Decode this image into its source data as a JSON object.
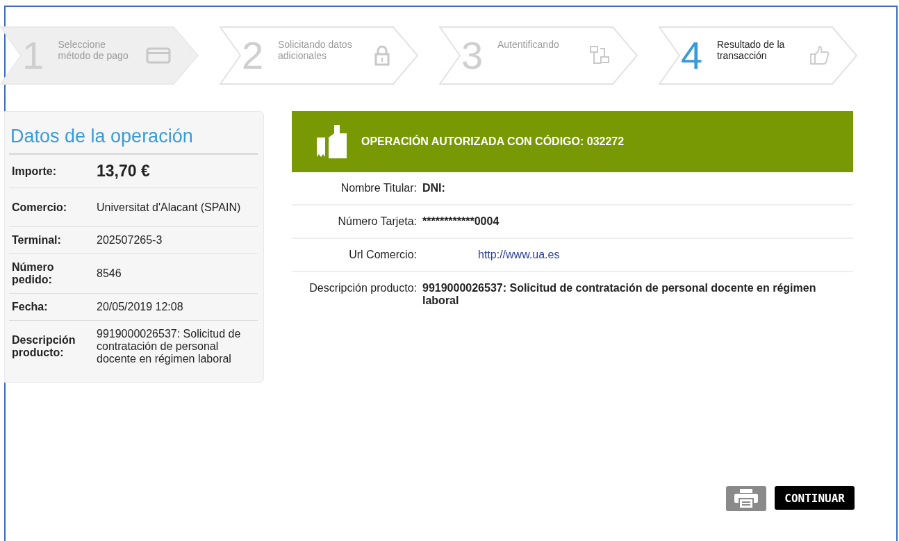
{
  "steps": [
    {
      "number": "1",
      "label": "Seleccione método de pago",
      "selected": false,
      "shaded": true
    },
    {
      "number": "2",
      "label": "Solicitando datos adicionales",
      "selected": false,
      "shaded": false
    },
    {
      "number": "3",
      "label": "Autentificando",
      "selected": false,
      "shaded": false
    },
    {
      "number": "4",
      "label": "Resultado de la transacción",
      "selected": true,
      "shaded": false
    }
  ],
  "operation": {
    "title": "Datos de la operación",
    "rows": [
      {
        "label": "Importe:",
        "value": "13,70 €",
        "kind": "amount"
      },
      {
        "label": "Comercio:",
        "value": "Universitat d'Alacant (SPAIN)",
        "kind": "spaced"
      },
      {
        "label": "Terminal:",
        "value": "202507265-3",
        "kind": "text"
      },
      {
        "label": "Número pedido:",
        "value": "8546",
        "kind": "text"
      },
      {
        "label": "Fecha:",
        "value": "20/05/2019  12:08",
        "kind": "text"
      },
      {
        "label": "Descripción producto:",
        "value": "9919000026537: Solicitud de contratación de personal docente en régimen laboral",
        "kind": "text"
      }
    ]
  },
  "result": {
    "banner": "OPERACIÓN AUTORIZADA CON CÓDIGO:  032272",
    "rows": [
      {
        "label": "Nombre Titular:",
        "value": "DNI:",
        "kind": "text"
      },
      {
        "label": "Número Tarjeta:",
        "value": "************0004",
        "kind": "text"
      },
      {
        "label": "Url Comercio:",
        "value": "http://www.ua.es",
        "kind": "link"
      },
      {
        "label": "Descripción producto:",
        "value": "9919000026537: Solicitud de contratación de personal docente en régimen laboral",
        "kind": "text"
      }
    ]
  },
  "buttons": {
    "continue": "CONTINUAR"
  }
}
